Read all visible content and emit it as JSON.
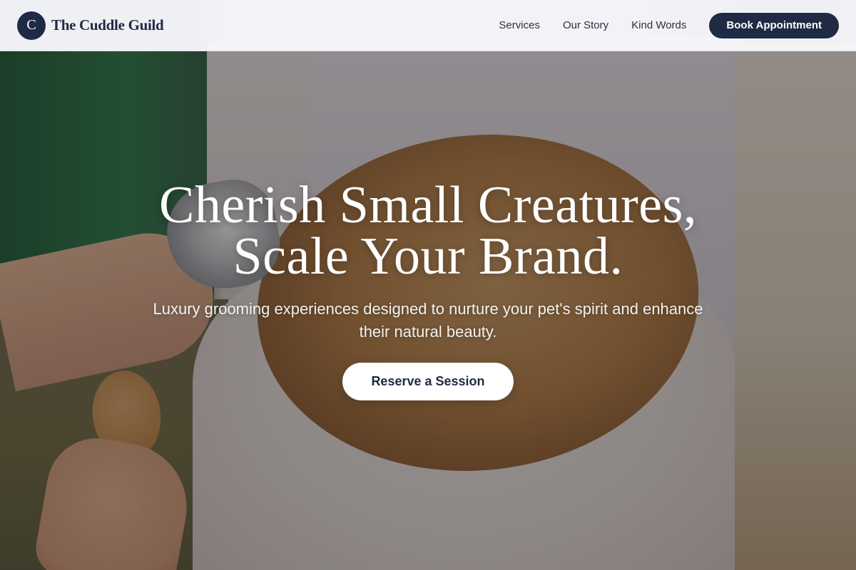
{
  "navbar": {
    "brand_initial": "C",
    "brand_name": "The Cuddle Guild",
    "links": [
      {
        "label": "Services"
      },
      {
        "label": "Our Story"
      },
      {
        "label": "Kind Words"
      }
    ],
    "cta_label": "Book Appointment"
  },
  "hero": {
    "title_line1": "Cherish Small Creatures,",
    "title_line2": "Scale Your Brand.",
    "subtitle": "Luxury grooming experiences designed to nurture your pet's spirit and enhance their natural beauty.",
    "cta_label": "Reserve a Session",
    "background_image": "hero-photo-grooming-dog"
  },
  "colors": {
    "brand_navy": "#1f2a44",
    "navbar_bg": "#f8f8fc",
    "hero_text": "#ffffff"
  }
}
